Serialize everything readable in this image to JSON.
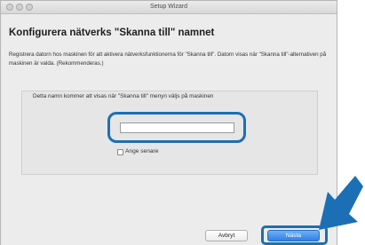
{
  "window": {
    "title": "Setup Wizard"
  },
  "page": {
    "title": "Konfigurera nätverks \"Skanna till\" namnet",
    "description": "Registrera datorn hos maskinen för att aktivera nätverksfunktionerna för \"Skanna till\". Datorn visas när \"Skanna till\"-alternativen på maskinen är valda. (Rekommenderas.)"
  },
  "form": {
    "caption": "Detta namn kommer att visas när \"Skanna till\" menyn väljs på maskinen",
    "name_value": "",
    "checkbox_label": "Ange senare",
    "checkbox_checked": false
  },
  "buttons": {
    "cancel": "Avbryt",
    "next": "Nästa"
  },
  "colors": {
    "highlight": "#1c6fb5",
    "primary_button": "#2f80e8"
  },
  "icons": [
    "close-icon",
    "minimize-icon",
    "zoom-icon",
    "pointer-arrow-icon"
  ]
}
